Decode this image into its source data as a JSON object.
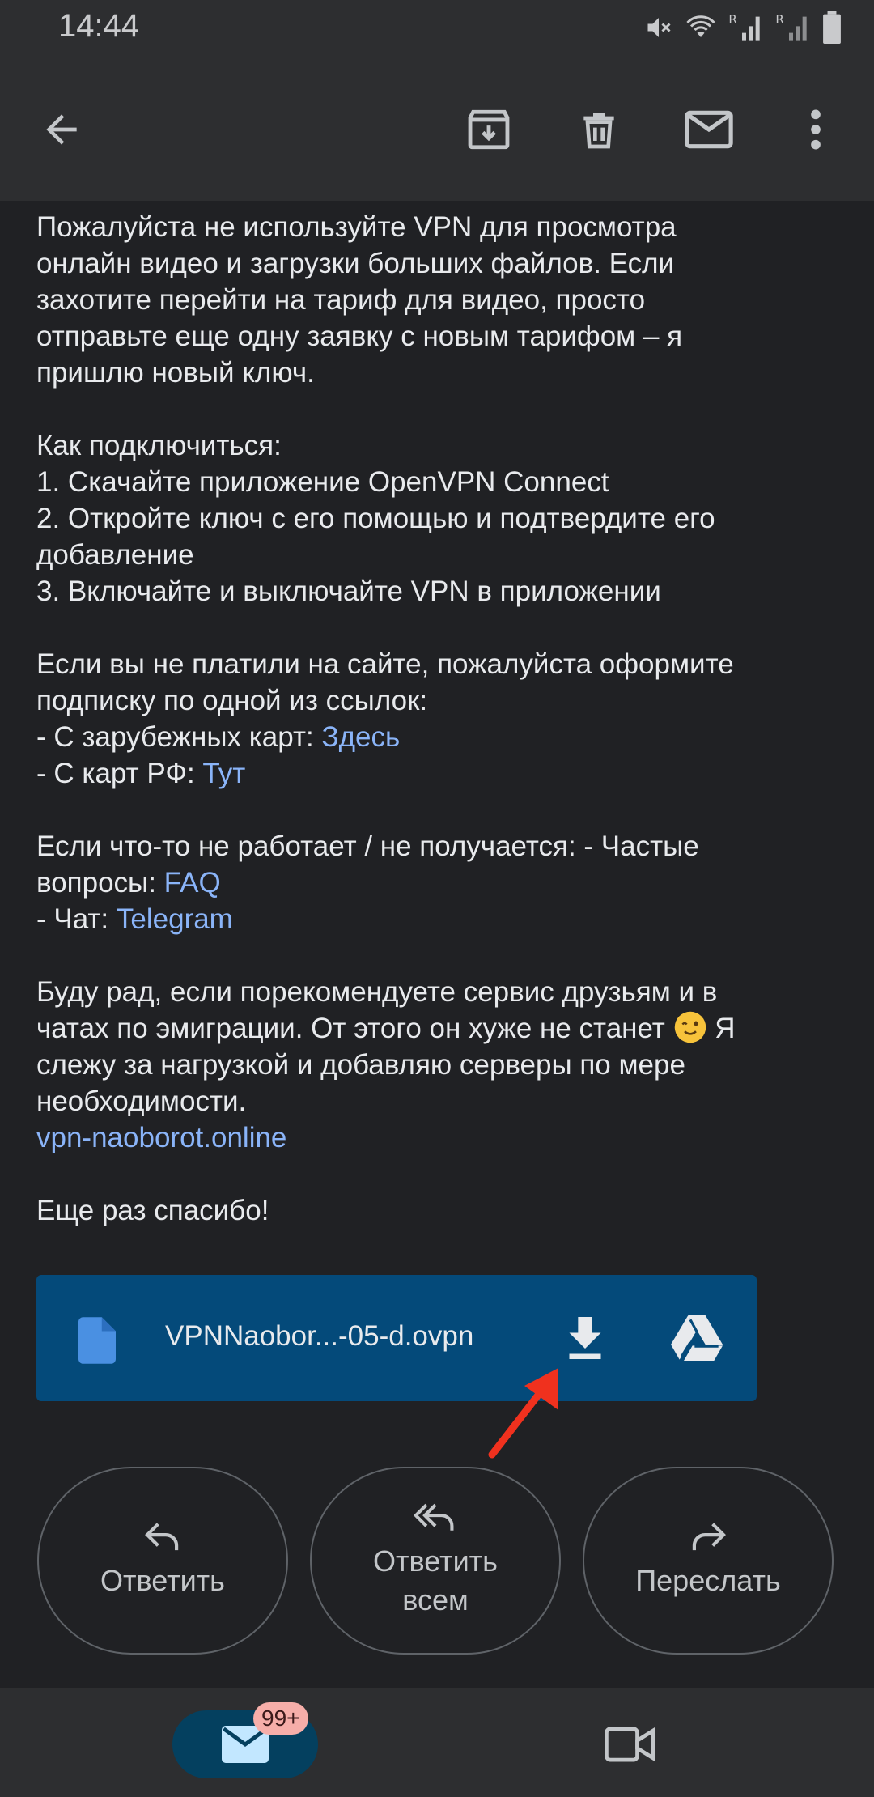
{
  "status_bar": {
    "time": "14:44"
  },
  "toolbar": {
    "back_icon": "arrow-back-icon",
    "archive_icon": "archive-icon",
    "delete_icon": "trash-icon",
    "mark_unread_icon": "mail-icon",
    "more_icon": "more-vert-icon"
  },
  "body": {
    "p1": [
      "Пожалуйста не используйте VPN для просмотра",
      "онлайн видео и загрузки больших файлов. Если",
      "захотите перейти на тариф для видео, просто",
      "отправьте еще одну заявку с новым тарифом – я",
      "пришлю новый ключ."
    ],
    "p2": [
      "Как подключиться:",
      "1. Скачайте приложение OpenVPN Connect",
      "2. Откройте ключ с его помощью и подтвердите его",
      "добавление",
      "3. Включайте и выключайте VPN в приложении"
    ],
    "p3": {
      "line1": "Если вы не платили на сайте, пожалуйста оформите",
      "line2": "подписку по одной из ссылок:",
      "foreign_prefix": "- С зарубежных карт: ",
      "foreign_link": "Здесь",
      "rf_prefix": "- С карт РФ: ",
      "rf_link": "Тут"
    },
    "p4": {
      "line1": "Если что-то не работает / не получается: - Частые",
      "faq_prefix": "вопросы: ",
      "faq_link": "FAQ",
      "chat_prefix": "- Чат: ",
      "chat_link": "Telegram"
    },
    "p5": {
      "line1": "Буду рад, если порекомендуете сервис друзьям и в",
      "line2a": "чатах по эмиграции. От этого он хуже не станет ",
      "line2b": " Я",
      "line3": "слежу за нагрузкой и добавляю серверы по мере",
      "line4": "необходимости.",
      "site_link": "vpn-naoborot.online"
    },
    "p6": "Еще раз спасибо!"
  },
  "attachment": {
    "filename": "VPNNaobor...-05-d.ovpn",
    "file_icon": "document-icon",
    "download_icon": "download-icon",
    "drive_icon": "google-drive-icon",
    "color": "#044a7a"
  },
  "actions": {
    "reply_label": "Ответить",
    "reply_all_line1": "Ответить",
    "reply_all_line2": "всем",
    "forward_label": "Переслать"
  },
  "bottom_nav": {
    "mail_badge": "99+",
    "mail_icon": "mail-icon",
    "meet_icon": "video-camera-icon"
  },
  "colors": {
    "link": "#8ab4f8",
    "background": "#202124",
    "bar": "#2d2e30",
    "annotation_arrow": "#f0311e"
  }
}
